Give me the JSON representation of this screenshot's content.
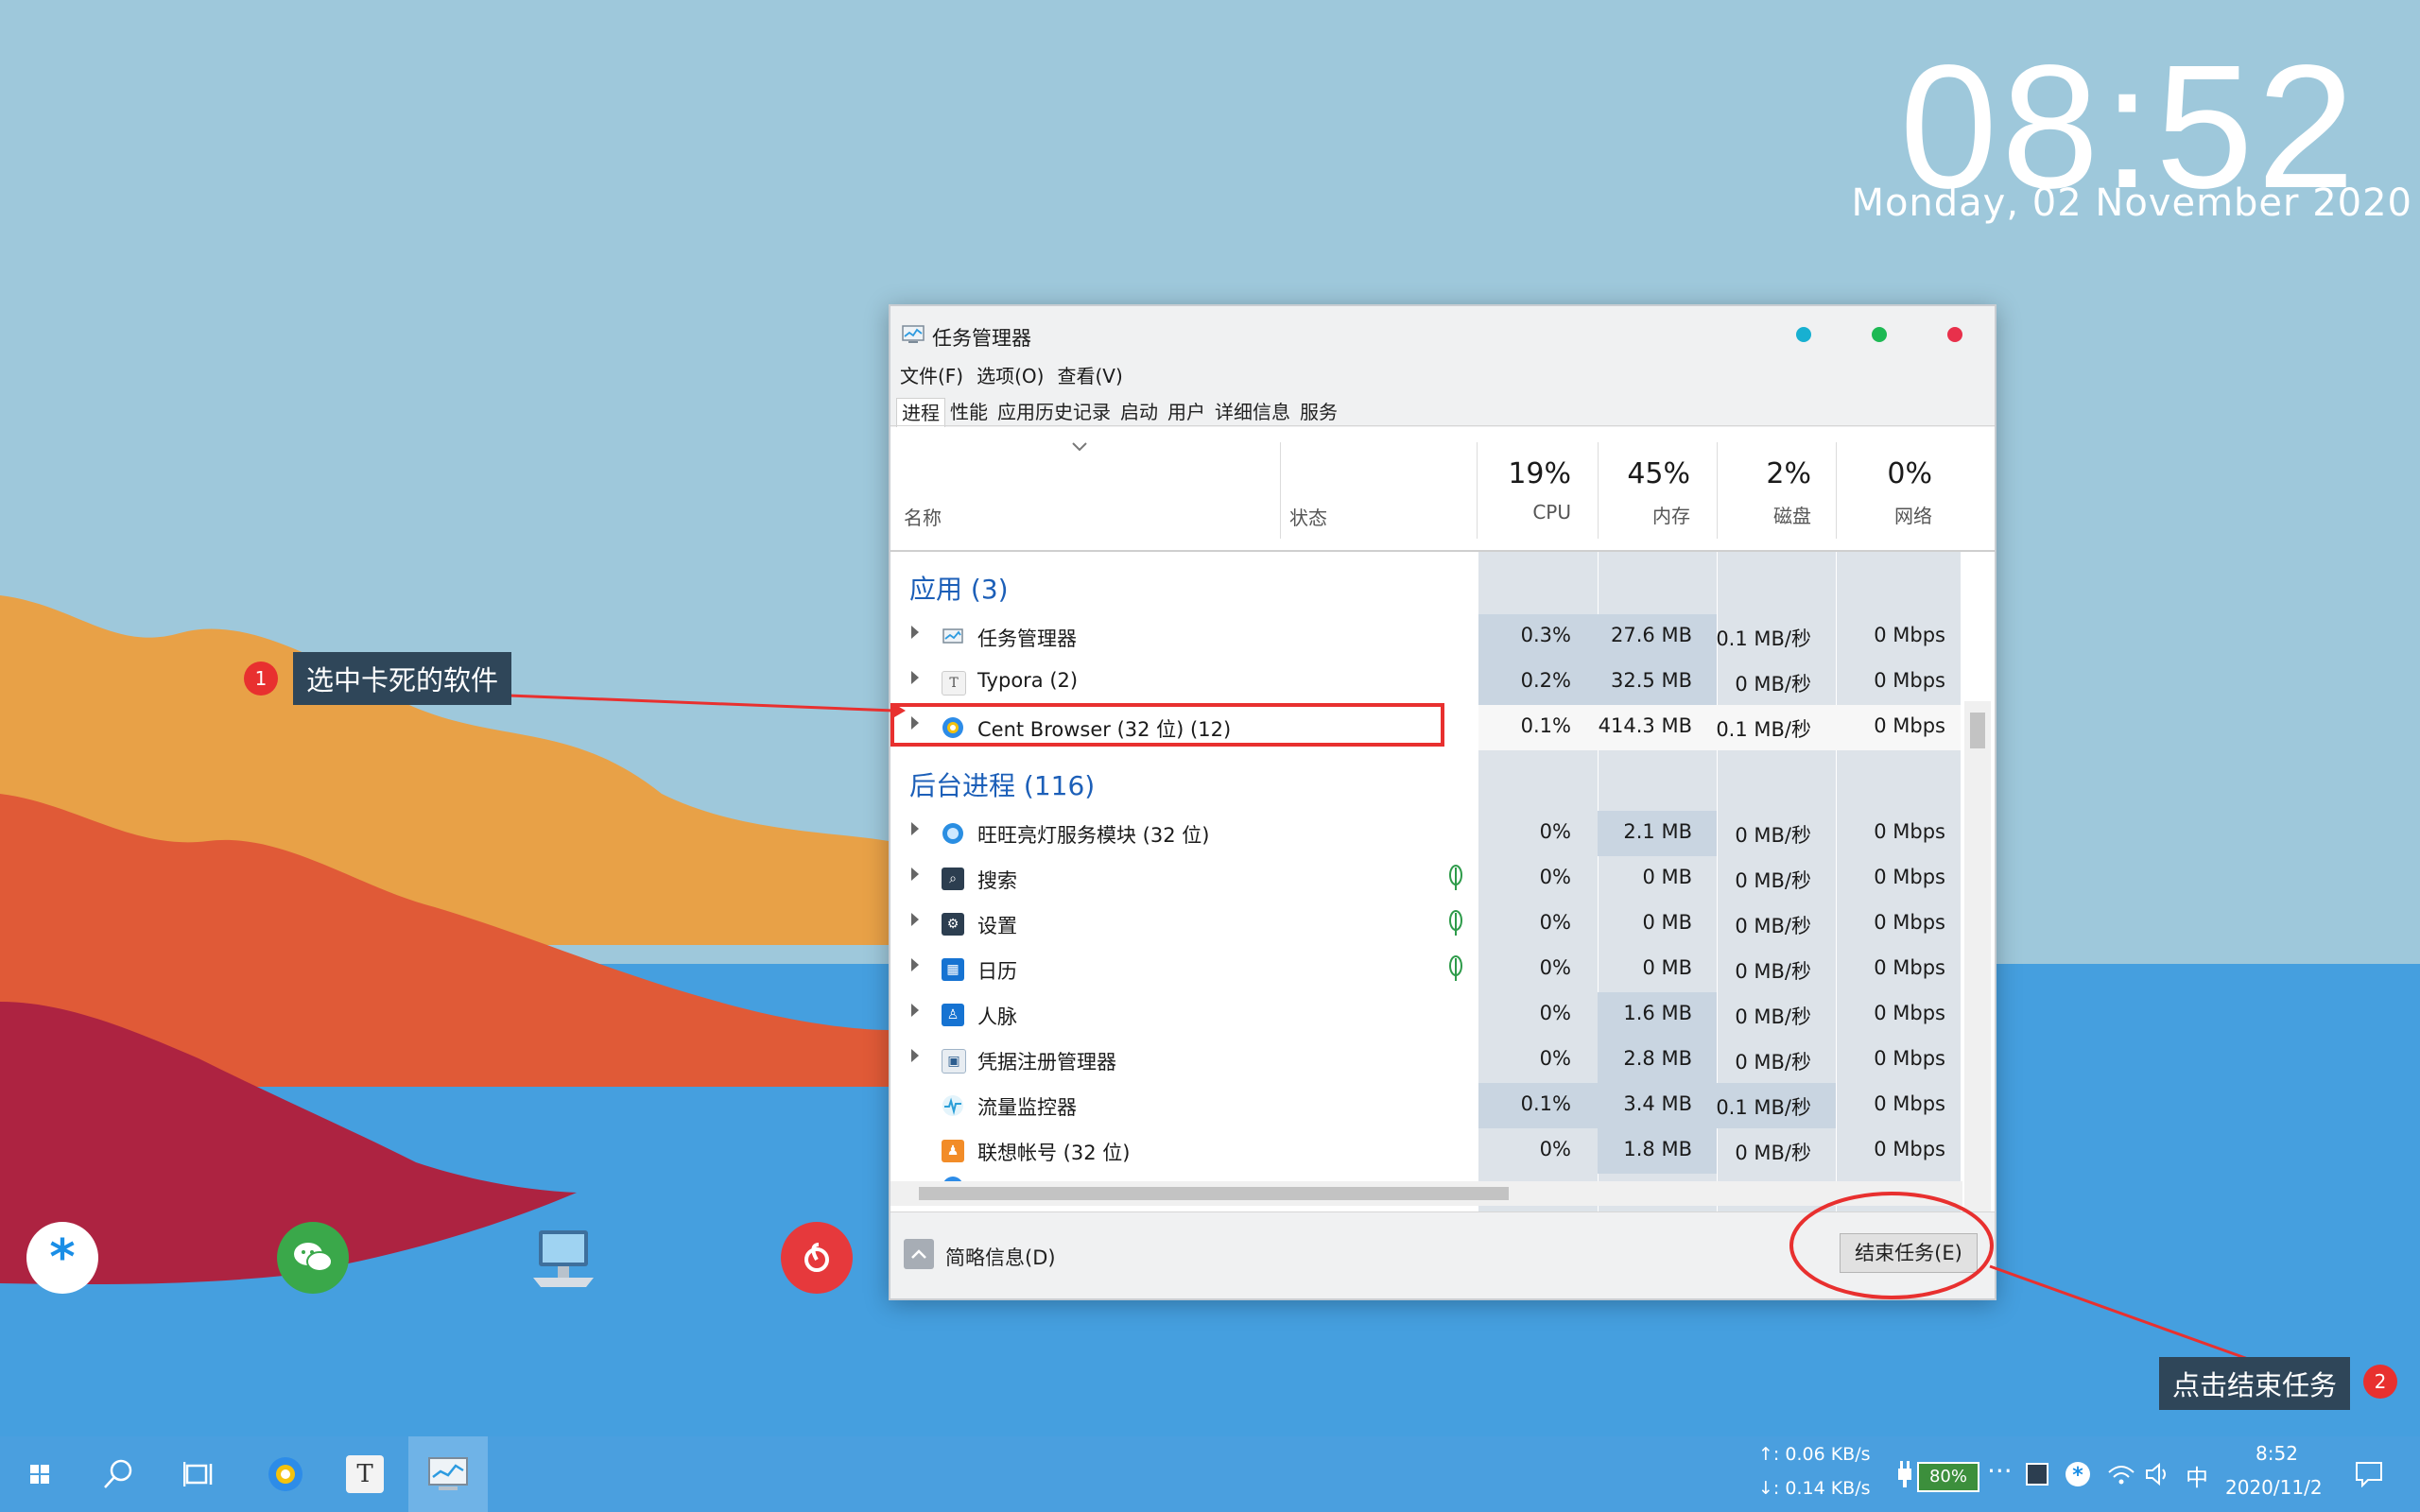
{
  "clock": {
    "time": "08:52",
    "date": "Monday, 02 November 2020"
  },
  "dock": {
    "icons": [
      "asterisk-app-icon",
      "wechat-icon",
      "my-computer-icon",
      "netease-music-icon"
    ]
  },
  "annotations": [
    {
      "badge": "1",
      "text": "选中卡死的软件"
    },
    {
      "badge": "2",
      "text": "点击结束任务"
    }
  ],
  "window": {
    "title": "任务管理器",
    "controls": {
      "minimize_color": "#17b0d1",
      "maximize_color": "#1db954",
      "close_color": "#e8304b"
    },
    "menu": [
      "文件(F)",
      "选项(O)",
      "查看(V)"
    ],
    "tabs": [
      "进程",
      "性能",
      "应用历史记录",
      "启动",
      "用户",
      "详细信息",
      "服务"
    ],
    "active_tab": "进程",
    "columns": {
      "name": "名称",
      "status": "状态",
      "cpu": {
        "pct": "19%",
        "label": "CPU"
      },
      "mem": {
        "pct": "45%",
        "label": "内存"
      },
      "disk": {
        "pct": "2%",
        "label": "磁盘"
      },
      "net": {
        "pct": "0%",
        "label": "网络"
      }
    },
    "groups": {
      "apps": "应用 (3)",
      "background": "后台进程 (116)"
    },
    "apps": [
      {
        "name": "任务管理器",
        "cpu": "0.3%",
        "mem": "27.6 MB",
        "disk": "0.1 MB/秒",
        "net": "0 Mbps",
        "icon": "task-manager-icon"
      },
      {
        "name": "Typora (2)",
        "cpu": "0.2%",
        "mem": "32.5 MB",
        "disk": "0 MB/秒",
        "net": "0 Mbps",
        "icon": "typora-icon"
      },
      {
        "name": "Cent Browser (32 位) (12)",
        "cpu": "0.1%",
        "mem": "414.3 MB",
        "disk": "0.1 MB/秒",
        "net": "0 Mbps",
        "icon": "cent-browser-icon",
        "selected": true
      }
    ],
    "background": [
      {
        "name": "旺旺亮灯服务模块 (32 位)",
        "cpu": "0%",
        "mem": "2.1 MB",
        "disk": "0 MB/秒",
        "net": "0 Mbps",
        "icon": "wangwang-icon"
      },
      {
        "name": "搜索",
        "cpu": "0%",
        "mem": "0 MB",
        "disk": "0 MB/秒",
        "net": "0 Mbps",
        "icon": "search-icon",
        "suspended": true
      },
      {
        "name": "设置",
        "cpu": "0%",
        "mem": "0 MB",
        "disk": "0 MB/秒",
        "net": "0 Mbps",
        "icon": "gear-icon",
        "suspended": true
      },
      {
        "name": "日历",
        "cpu": "0%",
        "mem": "0 MB",
        "disk": "0 MB/秒",
        "net": "0 Mbps",
        "icon": "calendar-icon",
        "suspended": true
      },
      {
        "name": "人脉",
        "cpu": "0%",
        "mem": "1.6 MB",
        "disk": "0 MB/秒",
        "net": "0 Mbps",
        "icon": "people-icon"
      },
      {
        "name": "凭据注册管理器",
        "cpu": "0%",
        "mem": "2.8 MB",
        "disk": "0 MB/秒",
        "net": "0 Mbps",
        "icon": "credential-icon"
      },
      {
        "name": "流量监控器",
        "cpu": "0.1%",
        "mem": "3.4 MB",
        "disk": "0.1 MB/秒",
        "net": "0 Mbps",
        "icon": "traffic-monitor-icon"
      },
      {
        "name": "联想帐号 (32 位)",
        "cpu": "0%",
        "mem": "1.8 MB",
        "disk": "0 MB/秒",
        "net": "0 Mbps",
        "icon": "lenovo-account-icon"
      }
    ],
    "footer": {
      "collapse_label": "简略信息(D)",
      "end_task_label": "结束任务(E)"
    }
  },
  "taskbar": {
    "net_up": "↑: 0.06 KB/s",
    "net_down": "↓: 0.14 KB/s",
    "battery": "80%",
    "ime": "中",
    "time": "8:52",
    "date": "2020/11/2"
  }
}
